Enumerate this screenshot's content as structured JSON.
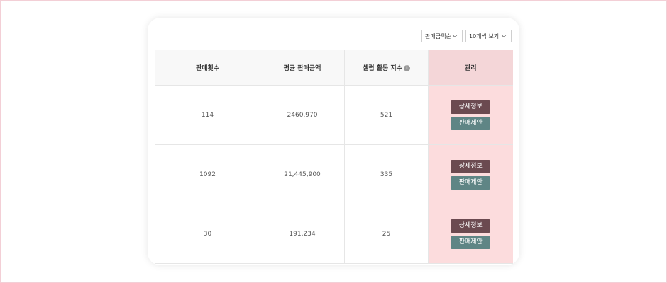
{
  "filters": {
    "sort": {
      "selected": "판매금액순"
    },
    "page_size": {
      "selected": "10개씩 보기"
    }
  },
  "table": {
    "headers": [
      "판매횟수",
      "평균 판매금액",
      "셀럽 활동 지수",
      "관리"
    ],
    "rows": [
      {
        "sales_count": "114",
        "avg_sales": "2460,970",
        "activity_index": "521"
      },
      {
        "sales_count": "1092",
        "avg_sales": "21,445,900",
        "activity_index": "335"
      },
      {
        "sales_count": "30",
        "avg_sales": "191,234",
        "activity_index": "25"
      }
    ],
    "actions": {
      "detail_label": "상세정보",
      "propose_label": "판매제안"
    }
  },
  "colors": {
    "manage_header_bg": "#f4d6d8",
    "manage_cell_bg": "#fcdcdd",
    "detail_button": "#6b4a50",
    "propose_button": "#5f8585"
  }
}
